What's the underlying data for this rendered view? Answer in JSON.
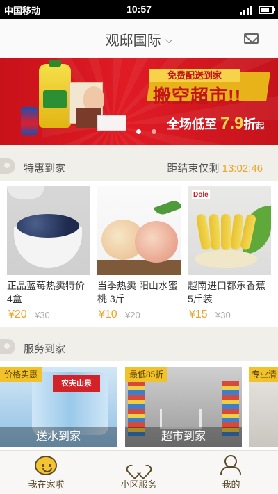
{
  "status": {
    "carrier": "中国移动",
    "time": "10:57"
  },
  "header": {
    "title": "观邸国际",
    "chevron": "⌵"
  },
  "banner": {
    "tag_free": "免费配送到家",
    "title": "搬空超市!!",
    "sub_prefix": "全场低至",
    "sub_num": "7.9",
    "sub_unit": "折",
    "sub_from": "起",
    "brand_on_can": "pepsi",
    "slide_count": 2
  },
  "deals_section": {
    "label": "特惠到家",
    "countdown_label": "距结束仅剩",
    "countdown": "13:02:46"
  },
  "deals": [
    {
      "name": "正品蓝莓热卖特价 4盒",
      "price": "¥20",
      "orig": "¥30",
      "image": "blueberry-image"
    },
    {
      "name": "当季热卖 阳山水蜜桃 3斤",
      "price": "¥10",
      "orig": "¥20",
      "image": "peach-image"
    },
    {
      "name": "越南进口都乐香蕉 5斤装",
      "price": "¥15",
      "orig": "¥30",
      "image": "banana-image",
      "brand": "Dole"
    }
  ],
  "services_section": {
    "label": "服务到家"
  },
  "services": [
    {
      "badge": "价格实惠",
      "caption": "送水到家",
      "water_brand": "农夫山泉"
    },
    {
      "badge": "最低85折",
      "caption": "超市到家"
    },
    {
      "badge": "专业清",
      "caption": ""
    }
  ],
  "tabs": [
    {
      "label": "我在家啦",
      "icon": "smile-icon"
    },
    {
      "label": "小区服务",
      "icon": "heart-icon"
    },
    {
      "label": "我的",
      "icon": "user-icon"
    }
  ],
  "colors": {
    "accent": "#e9a42b",
    "banner_red": "#d21820",
    "tab_text": "#5a4a2a"
  }
}
